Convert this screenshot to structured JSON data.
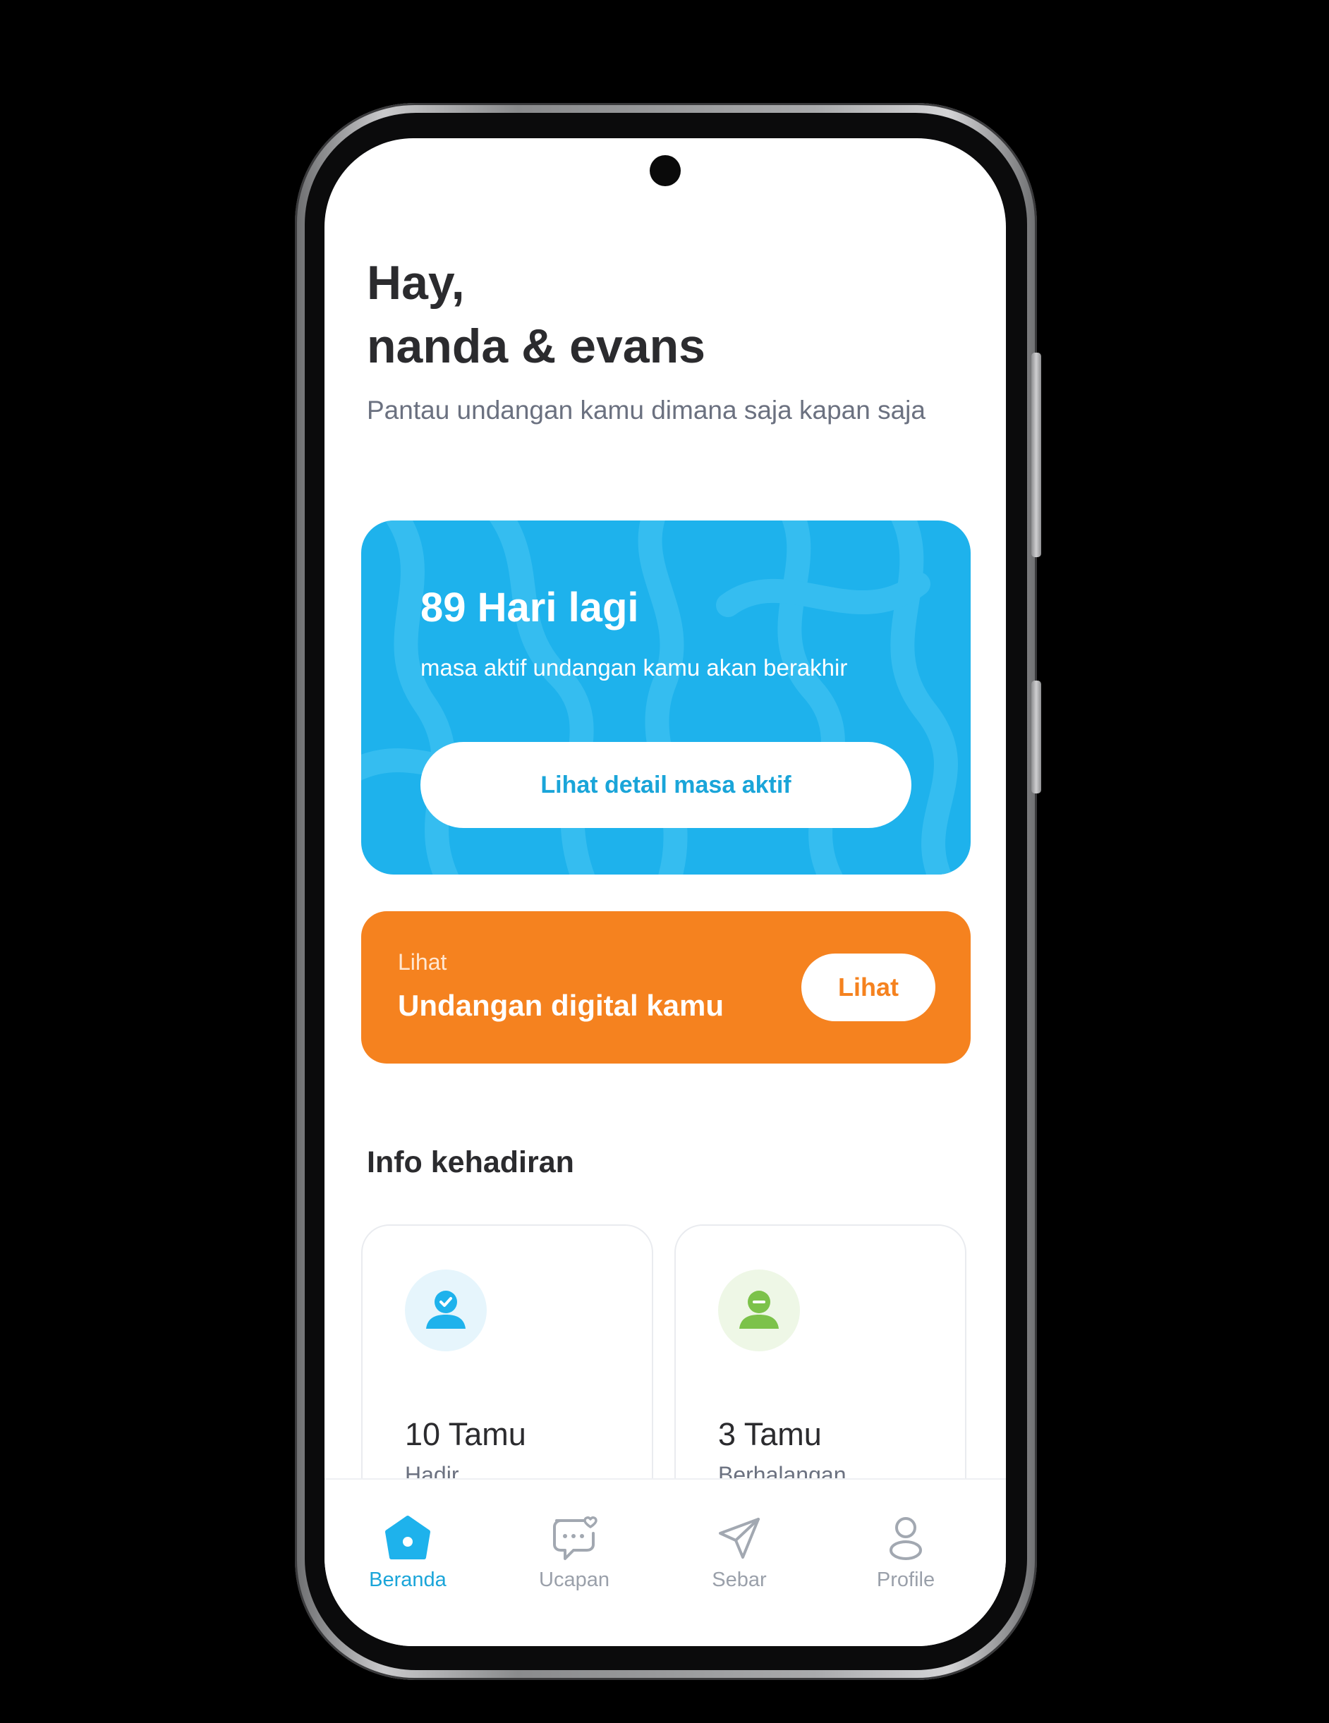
{
  "greeting": {
    "line1": "Hay,",
    "line2": "nanda & evans",
    "subtitle": "Pantau undangan kamu dimana saja kapan saja"
  },
  "active_card": {
    "days_left": "89 Hari lagi",
    "description": "masa aktif undangan kamu akan berakhir",
    "button_label": "Lihat detail masa aktif",
    "color": "#1eb2ec"
  },
  "invite_card": {
    "small_label": "Lihat",
    "title": "Undangan digital kamu",
    "button_label": "Lihat",
    "color": "#f5821f"
  },
  "attendance": {
    "title": "Info kehadiran",
    "cards": [
      {
        "count": "10 Tamu",
        "label": "Hadir",
        "icon": "user-check-icon",
        "color": "#1eb2ec"
      },
      {
        "count": "3 Tamu",
        "label": "Berhalangan",
        "icon": "user-minus-icon",
        "color": "#7cc24a"
      }
    ]
  },
  "nav": {
    "items": [
      {
        "label": "Beranda",
        "icon": "home-icon",
        "active": true
      },
      {
        "label": "Ucapan",
        "icon": "chat-heart-icon",
        "active": false
      },
      {
        "label": "Sebar",
        "icon": "send-icon",
        "active": false
      },
      {
        "label": "Profile",
        "icon": "profile-icon",
        "active": false
      }
    ],
    "active_color": "#1aa5d9",
    "inactive_color": "#9aa0aa"
  }
}
